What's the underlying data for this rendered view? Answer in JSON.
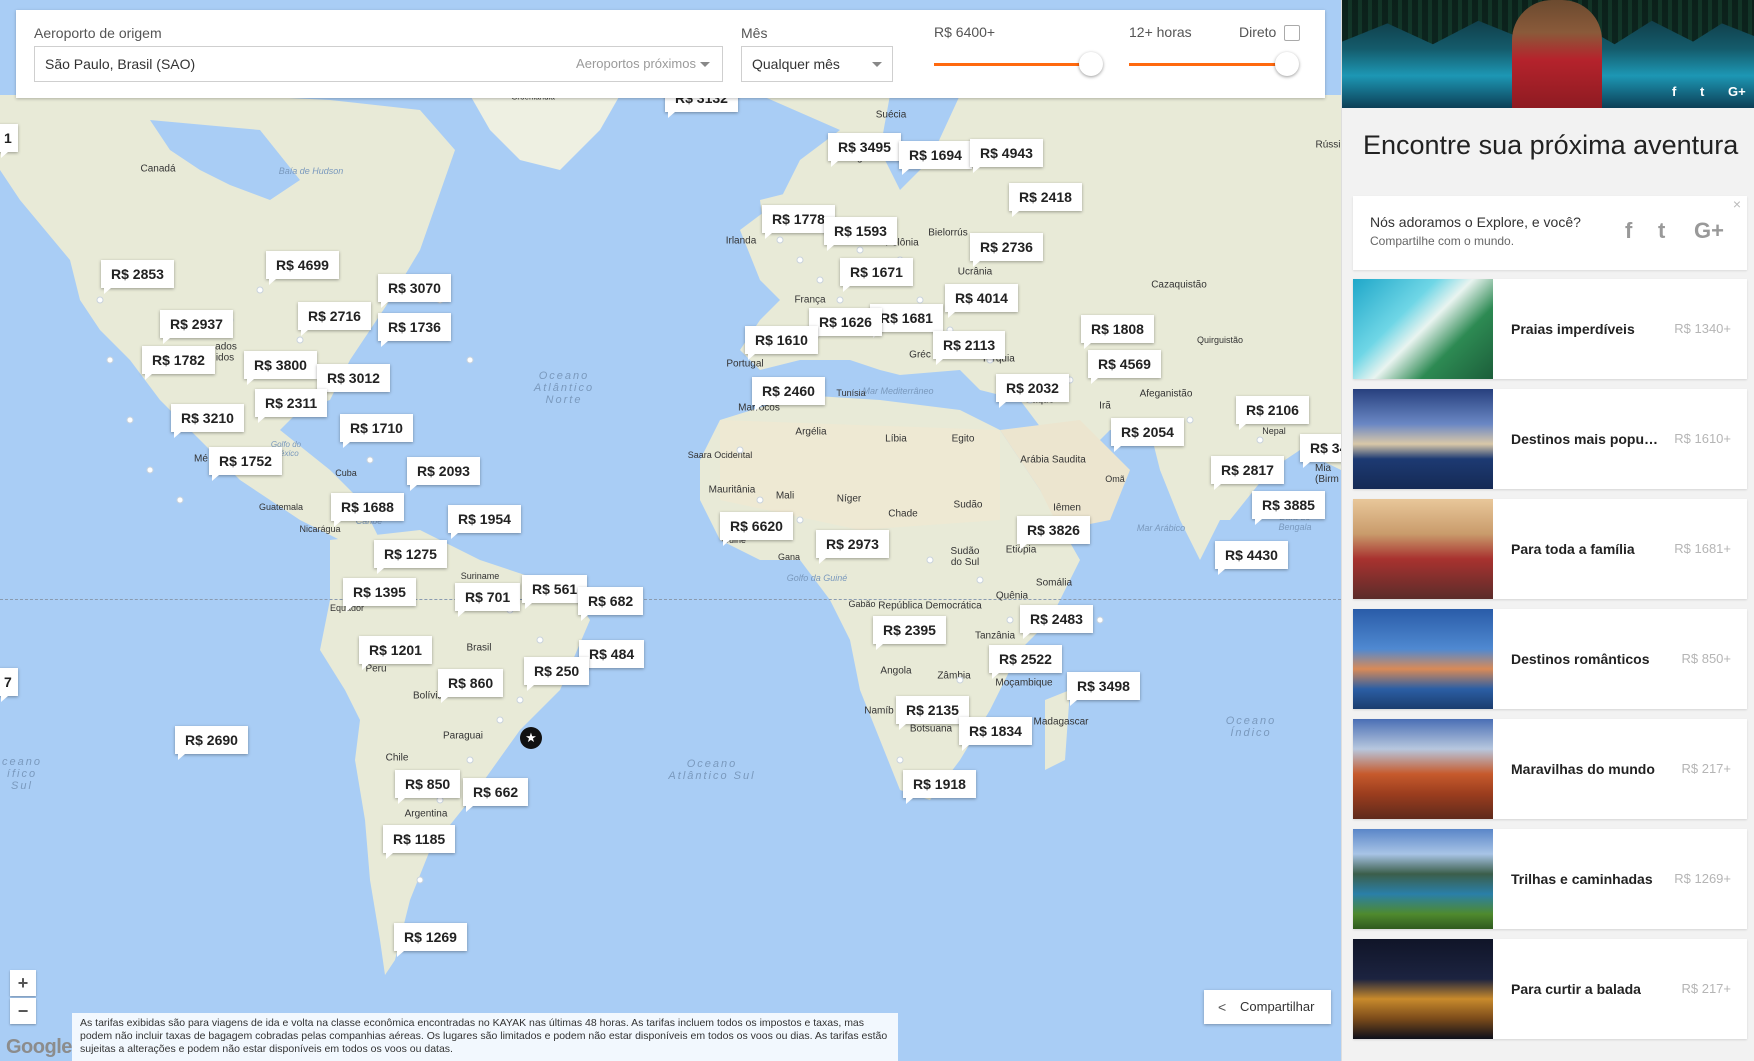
{
  "search": {
    "origin_label": "Aeroporto de origem",
    "origin_value": "São Paulo, Brasil (SAO)",
    "nearby_airports": "Aeroportos próximos",
    "month_label": "Mês",
    "month_value": "Qualquer mês",
    "price_label": "R$ 6400+",
    "price_level_pct": 100,
    "duration_label": "12+ horas",
    "duration_level_pct": 100,
    "direct_label": "Direto",
    "direct_checked": false,
    "accent_color": "#ff690f"
  },
  "map": {
    "geo_labels": {
      "canada": "Canadá",
      "hudson": "Baía de Hudson",
      "groenlandia": "Groenlândia",
      "suecia": "Suécia",
      "noruega": "Noruega",
      "russia": "Rússi",
      "irlanda": "Irlanda",
      "polonia": "Polônia",
      "bielorrus": "Bielorrús",
      "ucrania": "Ucrânia",
      "cazaquistao": "Cazaquistão",
      "franca": "França",
      "portugal": "Portugal",
      "grecia": "Gréc",
      "turquia": "Turquia",
      "tunisia": "Tunísia",
      "mediterraneo": "Mar Mediterrâneo",
      "marrocos": "Marrocos",
      "argelia": "Argélia",
      "libia": "Líbia",
      "egito": "Egito",
      "iraque": "Iraque",
      "ira": "Irã",
      "afeganistao": "Afeganistão",
      "arabia": "Arábia Saudita",
      "oma": "Omã",
      "saara": "Saara Ocidental",
      "mauritania": "Mauritânia",
      "mali": "Mali",
      "niger": "Níger",
      "chade": "Chade",
      "sudao": "Sudão",
      "iemen": "Iêmen",
      "guine": "Guiné",
      "gana": "Gana",
      "golfo_guine": "Golfo da Guiné",
      "sudao_sul": "Sudão do Sul",
      "etiopia": "Etiópia",
      "somalia": "Somália",
      "gabao": "Gabão",
      "rep_congo": "República Democrática",
      "quenia": "Quênia",
      "tanzania": "Tanzânia",
      "angola": "Angola",
      "zambia": "Zâmbia",
      "mocambique": "Moçambique",
      "namibia": "Namíb",
      "botsuana": "Botsuana",
      "madagascar": "Madagascar",
      "mar_arabico": "Mar Arábico",
      "nepal": "Nepal",
      "bengala": "Baía de Bengala",
      "cuba": "Cuba",
      "guatemala": "Guatemala",
      "nicaragua": "Nicarágua",
      "caribe": "Caribe",
      "golfo_mexico": "Golfo do México",
      "suriname": "Suriname",
      "equador": "Equador",
      "brasil": "Brasil",
      "peru": "Peru",
      "bolivia": "Bolívia",
      "paraguai": "Paraguai",
      "chile": "Chile",
      "argentina": "Argentina",
      "quirguistao": "Quirguistão",
      "atl_norte": "Oceano Atlântico Norte",
      "atl_sul": "Oceano Atlântico Sul",
      "indico": "Oceano Índico",
      "pacifico_sul": "ceano ífico Sul"
    },
    "prices": [
      {
        "id": "p3132",
        "label": "R$ 3132"
      },
      {
        "id": "p3495",
        "label": "R$ 3495"
      },
      {
        "id": "p1694",
        "label": "R$ 1694"
      },
      {
        "id": "p4943",
        "label": "R$ 4943"
      },
      {
        "id": "p2418",
        "label": "R$ 2418"
      },
      {
        "id": "p1778",
        "label": "R$ 1778"
      },
      {
        "id": "p1593",
        "label": "R$ 1593"
      },
      {
        "id": "p2736",
        "label": "R$ 2736"
      },
      {
        "id": "p1671",
        "label": "R$ 1671"
      },
      {
        "id": "p4014",
        "label": "R$ 4014"
      },
      {
        "id": "p1681",
        "label": "R$ 1681"
      },
      {
        "id": "p1626",
        "label": "R$ 1626"
      },
      {
        "id": "p1610",
        "label": "R$ 1610"
      },
      {
        "id": "p2113",
        "label": "R$ 2113"
      },
      {
        "id": "p1808",
        "label": "R$ 1808"
      },
      {
        "id": "p4569",
        "label": "R$ 4569"
      },
      {
        "id": "p2460",
        "label": "R$ 2460"
      },
      {
        "id": "p2032",
        "label": "R$ 2032"
      },
      {
        "id": "p2054",
        "label": "R$ 2054"
      },
      {
        "id": "p2106",
        "label": "R$ 2106"
      },
      {
        "id": "p34",
        "label": "R$ 34"
      },
      {
        "id": "p2817",
        "label": "R$ 2817"
      },
      {
        "id": "p3885",
        "label": "R$ 3885"
      },
      {
        "id": "p6620",
        "label": "R$ 6620"
      },
      {
        "id": "p3826",
        "label": "R$ 3826"
      },
      {
        "id": "p2973",
        "label": "R$ 2973"
      },
      {
        "id": "p4430",
        "label": "R$ 4430"
      },
      {
        "id": "p2483",
        "label": "R$ 2483"
      },
      {
        "id": "p2395",
        "label": "R$ 2395"
      },
      {
        "id": "p2522",
        "label": "R$ 2522"
      },
      {
        "id": "p3498",
        "label": "R$ 3498"
      },
      {
        "id": "p2135",
        "label": "R$ 2135"
      },
      {
        "id": "p1834",
        "label": "R$ 1834"
      },
      {
        "id": "p1918",
        "label": "R$ 1918"
      },
      {
        "id": "p2853",
        "label": "R$ 2853"
      },
      {
        "id": "p4699",
        "label": "R$ 4699"
      },
      {
        "id": "p3070",
        "label": "R$ 3070"
      },
      {
        "id": "p2716",
        "label": "R$ 2716"
      },
      {
        "id": "p2937",
        "label": "R$ 2937"
      },
      {
        "id": "p1736",
        "label": "R$ 1736"
      },
      {
        "id": "p1782",
        "label": "R$ 1782"
      },
      {
        "id": "p3800",
        "label": "R$ 3800"
      },
      {
        "id": "p3012",
        "label": "R$ 3012"
      },
      {
        "id": "p2311",
        "label": "R$ 2311"
      },
      {
        "id": "p3210",
        "label": "R$ 3210"
      },
      {
        "id": "p1710",
        "label": "R$ 1710"
      },
      {
        "id": "p1752",
        "label": "R$ 1752"
      },
      {
        "id": "p2093",
        "label": "R$ 2093"
      },
      {
        "id": "p1688",
        "label": "R$ 1688"
      },
      {
        "id": "p1954",
        "label": "R$ 1954"
      },
      {
        "id": "p1275",
        "label": "R$ 1275"
      },
      {
        "id": "p1395",
        "label": "R$ 1395"
      },
      {
        "id": "p701",
        "label": "R$ 701"
      },
      {
        "id": "p561",
        "label": "R$ 561"
      },
      {
        "id": "p682",
        "label": "R$ 682"
      },
      {
        "id": "p484",
        "label": "R$ 484"
      },
      {
        "id": "p1201",
        "label": "R$ 1201"
      },
      {
        "id": "p860",
        "label": "R$ 860"
      },
      {
        "id": "p250",
        "label": "R$ 250"
      },
      {
        "id": "p2690",
        "label": "R$ 2690"
      },
      {
        "id": "p850",
        "label": "R$ 850"
      },
      {
        "id": "p662",
        "label": "R$ 662"
      },
      {
        "id": "p1185",
        "label": "R$ 1185"
      },
      {
        "id": "p1269",
        "label": "R$ 1269"
      }
    ],
    "edge_labels": {
      "left_top": "1",
      "left_mid": "7",
      "me": "Mé",
      "ados": "ados",
      "idos": "idos",
      "ruecia": "Mia (Birm"
    },
    "zoom_in": "+",
    "zoom_out": "−",
    "share_label": "Compartilhar",
    "disclaimer": "As tarifas exibidas são para viagens de ida e volta na classe econômica encontradas no KAYAK nas últimas 48 horas. As tarifas incluem todos os impostos e taxas, mas podem não incluir taxas de bagagem cobradas pelas companhias aéreas. Os lugares são limitados e podem não estar disponíveis em todos os voos ou dias. As tarifas estão sujeitas a alterações e podem não estar disponíveis em todos os voos ou datas.",
    "google_logo": "Google",
    "origin_marker_icon": "★"
  },
  "sidebar": {
    "hero_social": [
      "f",
      "t",
      "G+"
    ],
    "title": "Encontre sua próxima aventura",
    "share_card": {
      "question": "Nós adoramos o Explore, e você?",
      "subtitle": "Compartilhe com o mundo.",
      "close": "×",
      "social": [
        "f",
        "t",
        "G+"
      ]
    },
    "categories": [
      {
        "label": "Praias imperdíveis",
        "price": "R$ 1340+",
        "thumb": "beach"
      },
      {
        "label": "Destinos mais populares",
        "price": "R$ 1610+",
        "thumb": "city"
      },
      {
        "label": "Para toda a família",
        "price": "R$ 1681+",
        "thumb": "family"
      },
      {
        "label": "Destinos românticos",
        "price": "R$ 850+",
        "thumb": "venice"
      },
      {
        "label": "Maravilhas do mundo",
        "price": "R$ 217+",
        "thumb": "canyon"
      },
      {
        "label": "Trilhas e caminhadas",
        "price": "R$ 1269+",
        "thumb": "mountains"
      },
      {
        "label": "Para curtir a balada",
        "price": "R$ 217+",
        "thumb": "night"
      }
    ]
  }
}
